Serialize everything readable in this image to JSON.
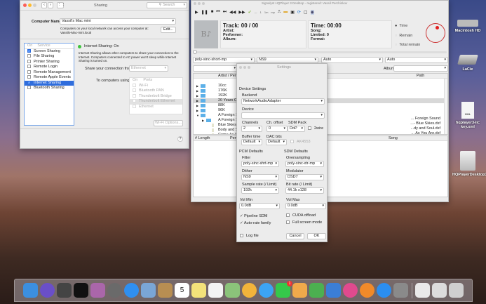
{
  "sharing": {
    "title": "Sharing",
    "search_placeholder": "Search",
    "computer_name_label": "Computer Name:",
    "computer_name": "Vassil's Mac mini",
    "access_note_1": "Computers on your local network can access your computer at:",
    "access_note_2": "Vassils-Mac-mini.local",
    "edit_label": "Edit...",
    "list_header_on": "On",
    "list_header_service": "Service",
    "services": [
      {
        "label": "Screen Sharing",
        "checked": true
      },
      {
        "label": "File Sharing",
        "checked": false
      },
      {
        "label": "Printer Sharing",
        "checked": false
      },
      {
        "label": "Remote Login",
        "checked": false
      },
      {
        "label": "Remote Management",
        "checked": false
      },
      {
        "label": "Remote Apple Events",
        "checked": false
      },
      {
        "label": "Internet Sharing",
        "checked": true,
        "selected": true
      },
      {
        "label": "Bluetooth Sharing",
        "checked": false
      }
    ],
    "status": "Internet Sharing: On",
    "description": "Internet Sharing allows other computers to share your connection to the Internet. Computers connected to AC power won't sleep while Internet Sharing is turned on.",
    "share_from_label": "Share your connection from:",
    "share_from_value": "Ethernet",
    "to_computers_label": "To computers using:",
    "ports_header_on": "On",
    "ports_header_ports": "Ports",
    "ports": [
      "Wi-Fi",
      "Bluetooth PAN",
      "Thunderbolt Bridge",
      "Thunderbolt Ethernet",
      "Ethernet"
    ],
    "wifi_options_label": "Wi-Fi Options...",
    "help_label": "?"
  },
  "player": {
    "title": "Signalyst HQPlayer 3 Desktop - registered: Vassil Perchinkov",
    "toolbar": [
      "play",
      "pause",
      "stop",
      "previous",
      "next",
      "rewind",
      "forward",
      "check",
      "minus",
      "one",
      "1m",
      "mp",
      "usb",
      "folder",
      "save",
      "refresh",
      "window",
      "speaker"
    ],
    "toolbar_text": {
      "minus": "---",
      "one": "1",
      "1m": "1m",
      "mp": "mp"
    },
    "art_text": "B♪",
    "track": "Track: 00 / 00",
    "artist": "Artist:",
    "performer": "Performer:",
    "album": "Album:",
    "time": "Time: 00:00",
    "song": "Song:",
    "limited": "Limited: 0",
    "format": "Format:",
    "radio": [
      {
        "label": "Time",
        "selected": true
      },
      {
        "label": "Remain",
        "selected": false
      },
      {
        "label": "Total remain",
        "selected": false
      }
    ],
    "selects": [
      "poly-sinc-short-mp",
      "NS9",
      "Auto",
      "Auto"
    ],
    "album_label": "Album:",
    "tree_header": "Artist / Performer",
    "path_header": "Path",
    "tree": [
      {
        "label": "10cc",
        "folder": true
      },
      {
        "label": "176K",
        "folder": true
      },
      {
        "label": "192K",
        "folder": true
      },
      {
        "label": "20 Years Ca",
        "folder": true,
        "selected": true
      },
      {
        "label": "88K",
        "folder": true
      },
      {
        "label": "96K",
        "folder": true
      },
      {
        "label": "A Foreign Sc",
        "folder": true,
        "open": true
      },
      {
        "label": "A Foreign Sc",
        "folder": true,
        "indent": 1
      },
      {
        "label": "Blue Skies",
        "indent": 2
      },
      {
        "label": "Body and Sc",
        "indent": 2
      },
      {
        "label": "Come As Yo",
        "indent": 2
      }
    ],
    "paths": [
      "... Foreign Sound",
      "...- Blue Skies.dsf",
      "...dy and Soul.dsf",
      "... As You Are.dsf"
    ],
    "playlist_headers": [
      "# Length",
      "Performer",
      "Song"
    ]
  },
  "settings": {
    "title": "Settings",
    "device_settings": "Device Settings",
    "backend_label": "Backend",
    "backend": "NetworkAudioAdapter",
    "device_label": "Device",
    "device": "",
    "channels_label": "Channels",
    "channels": "2",
    "offset_label": "Ch. offset",
    "offset": "0",
    "sdm_pack_label": "SDM Pack",
    "sdm_pack": "DoP",
    "twowire_label": "2wire",
    "buffer_label": "Buffer time",
    "buffer": "Default",
    "dacbits_label": "DAC bits",
    "dacbits": "Default",
    "ak4xxx_label": "AK4553",
    "pcm_defaults": "PCM Defaults",
    "sdm_defaults": "SDM Defaults",
    "filter_label": "Filter",
    "filter": "poly-sinc-shrt-mp",
    "oversampling_label": "Oversampling",
    "oversampling": "poly-sinc-xtr-mp",
    "dither_label": "Dither",
    "dither": "NS9",
    "modulator_label": "Modulator",
    "modulator": "DSD7",
    "samplerate_label": "Sample rate (/ Limit)",
    "samplerate": "192k",
    "bitrate_label": "Bit rate (/ Limit)",
    "bitrate": "44.1k x128",
    "volmin_label": "Vol Min",
    "volmin": "0.0dB",
    "volmax_label": "Vol Max",
    "volmax": "0.0dB",
    "pipeline_label": "Pipeline SDM",
    "pipeline": true,
    "cuda_label": "CUDA offload",
    "cuda": false,
    "autorate_label": "Auto-rate family",
    "autorate": true,
    "fullscreen_label": "Full screen mode",
    "fullscreen": false,
    "logfile_label": "Log file",
    "logfile": false,
    "cancel_label": "Cancel",
    "ok_label": "OK"
  },
  "desktop": [
    "Macintosh HD",
    "LaCie",
    "hqplayer3-lic key.xml",
    "HQPlayerDesktop3"
  ],
  "desktop_xml_badge": "XML",
  "dock": [
    "finder",
    "siri",
    "dark-app",
    "tidal",
    "audio-app",
    "launchpad",
    "safari",
    "preview",
    "contacts",
    "calendar",
    "notes",
    "reminders",
    "maps",
    "photos",
    "messages",
    "facetime",
    "pages",
    "numbers",
    "keynote",
    "itunes",
    "ibooks",
    "app-store",
    "system-preferences",
    "downloads",
    "documents",
    "trash"
  ],
  "dock_colors": [
    "#3c8fe0",
    "#6a4fc8",
    "#444444",
    "#111111",
    "#aa66aa",
    "#6a6a6a",
    "#2f8ff0",
    "#7aa6d6",
    "#b88e52",
    "#ffffff",
    "#f3e27a",
    "#f4f4f4",
    "#8bc37a",
    "#f2b43b",
    "#3ca4f4",
    "#35c84a",
    "#f0a94b",
    "#4cb050",
    "#3b7ed6",
    "#e04a8e",
    "#f08a2a",
    "#2b8ef0",
    "#8a8a8a",
    "#e9e9e9",
    "#dcdcdc",
    "#cfcfcf"
  ],
  "calendar_day": "5",
  "facetime_badge": "1"
}
